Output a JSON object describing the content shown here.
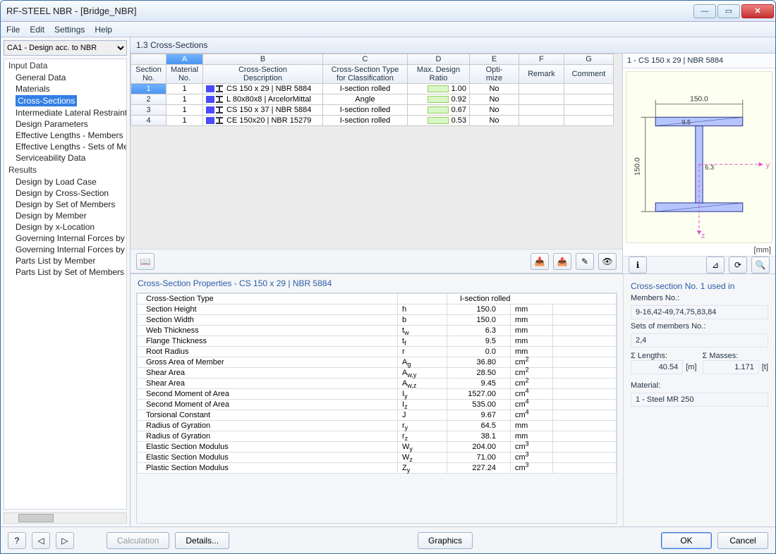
{
  "window_title": "RF-STEEL NBR - [Bridge_NBR]",
  "menu": [
    "File",
    "Edit",
    "Settings",
    "Help"
  ],
  "case_combo": "CA1 - Design acc. to NBR",
  "tree": {
    "input_header": "Input Data",
    "input_items": [
      "General Data",
      "Materials",
      "Cross-Sections",
      "Intermediate Lateral Restraints",
      "Design Parameters",
      "Effective Lengths - Members",
      "Effective Lengths - Sets of Mem",
      "Serviceability Data"
    ],
    "input_selected_index": 2,
    "results_header": "Results",
    "results_items": [
      "Design by Load Case",
      "Design by Cross-Section",
      "Design by Set of Members",
      "Design by Member",
      "Design by x-Location",
      "Governing Internal Forces by M",
      "Governing Internal Forces by S",
      "Parts List by Member",
      "Parts List by Set of Members"
    ]
  },
  "pane_title": "1.3 Cross-Sections",
  "grid": {
    "col_letters": [
      "A",
      "B",
      "C",
      "D",
      "E",
      "F",
      "G"
    ],
    "headers": {
      "section_no": "Section\nNo.",
      "material_no": "Material\nNo.",
      "cs_desc": "Cross-Section\nDescription",
      "cs_type": "Cross-Section Type\nfor Classification",
      "ratio": "Max. Design\nRatio",
      "optimize": "Opti-\nmize",
      "remark": "Remark",
      "comment": "Comment"
    },
    "rows": [
      {
        "no": "1",
        "mat": "1",
        "desc": "CS 150 x 29 | NBR 5884",
        "type": "I-section rolled",
        "ratio": "1.00",
        "opt": "No"
      },
      {
        "no": "2",
        "mat": "1",
        "desc": "L 80x80x8 | ArcelorMittal",
        "type": "Angle",
        "ratio": "0.92",
        "opt": "No"
      },
      {
        "no": "3",
        "mat": "1",
        "desc": "CS 150 x 37 | NBR 5884",
        "type": "I-section rolled",
        "ratio": "0.67",
        "opt": "No"
      },
      {
        "no": "4",
        "mat": "1",
        "desc": "CE 150x20 | NBR 15279",
        "type": "I-section rolled",
        "ratio": "0.53",
        "opt": "No"
      }
    ]
  },
  "preview": {
    "title": "1 - CS 150 x 29 | NBR 5884",
    "unit": "[mm]",
    "dim_w": "150.0",
    "dim_h": "150.0",
    "dim_tf": "9.5",
    "dim_tw": "6.3",
    "axis_y": "y",
    "axis_z": "z"
  },
  "props_title": "Cross-Section Properties  -  CS 150 x 29 | NBR 5884",
  "props": [
    {
      "name": "Cross-Section Type",
      "sym": "",
      "val": "I-section rolled",
      "unit": ""
    },
    {
      "name": "Section Height",
      "sym": "h",
      "val": "150.0",
      "unit": "mm"
    },
    {
      "name": "Section Width",
      "sym": "b",
      "val": "150.0",
      "unit": "mm"
    },
    {
      "name": "Web Thickness",
      "sym": "t_w",
      "val": "6.3",
      "unit": "mm"
    },
    {
      "name": "Flange Thickness",
      "sym": "t_f",
      "val": "9.5",
      "unit": "mm"
    },
    {
      "name": "Root Radius",
      "sym": "r",
      "val": "0.0",
      "unit": "mm"
    },
    {
      "name": "Gross Area of Member",
      "sym": "A_g",
      "val": "36.80",
      "unit": "cm2"
    },
    {
      "name": "Shear Area",
      "sym": "A_w,y",
      "val": "28.50",
      "unit": "cm2"
    },
    {
      "name": "Shear Area",
      "sym": "A_w,z",
      "val": "9.45",
      "unit": "cm2"
    },
    {
      "name": "Second Moment of Area",
      "sym": "I_y",
      "val": "1527.00",
      "unit": "cm4"
    },
    {
      "name": "Second Moment of Area",
      "sym": "I_z",
      "val": "535.00",
      "unit": "cm4"
    },
    {
      "name": "Torsional Constant",
      "sym": "J",
      "val": "9.67",
      "unit": "cm4"
    },
    {
      "name": "Radius of Gyration",
      "sym": "r_y",
      "val": "64.5",
      "unit": "mm"
    },
    {
      "name": "Radius of Gyration",
      "sym": "r_z",
      "val": "38.1",
      "unit": "mm"
    },
    {
      "name": "Elastic Section Modulus",
      "sym": "W_y",
      "val": "204.00",
      "unit": "cm3"
    },
    {
      "name": "Elastic Section Modulus",
      "sym": "W_z",
      "val": "71.00",
      "unit": "cm3"
    },
    {
      "name": "Plastic Section Modulus",
      "sym": "Z_y",
      "val": "227.24",
      "unit": "cm3"
    }
  ],
  "info": {
    "used_in": "Cross-section No. 1 used in",
    "members_label": "Members No.:",
    "members": "9-16,42-49,74,75,83,84",
    "sets_label": "Sets of members No.:",
    "sets": "2,4",
    "sum_len_label": "Σ Lengths:",
    "sum_len": "40.54",
    "sum_len_unit": "[m]",
    "sum_mass_label": "Σ Masses:",
    "sum_mass": "1.171",
    "sum_mass_unit": "[t]",
    "material_label": "Material:",
    "material": "1 - Steel MR 250"
  },
  "footer": {
    "calculation": "Calculation",
    "details": "Details...",
    "graphics": "Graphics",
    "ok": "OK",
    "cancel": "Cancel"
  }
}
